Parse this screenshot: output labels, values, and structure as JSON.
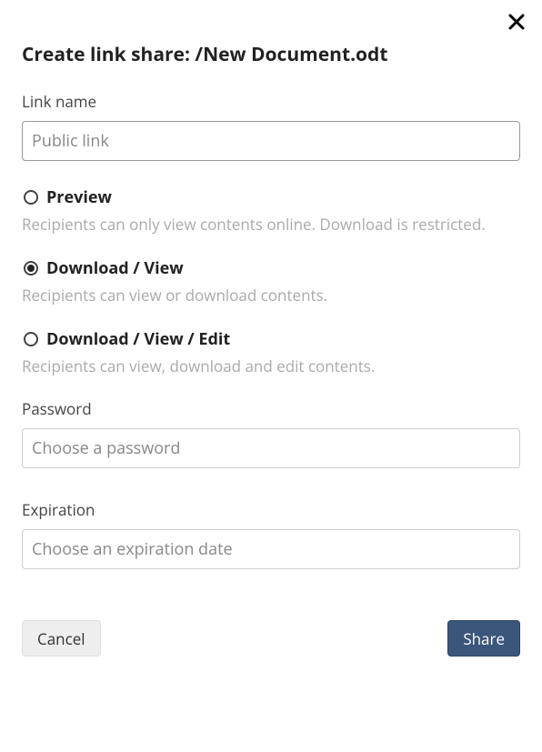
{
  "title": "Create link share: /New Document.odt",
  "linkName": {
    "label": "Link name",
    "placeholder": "Public link",
    "value": ""
  },
  "options": [
    {
      "id": "preview",
      "label": "Preview",
      "description": "Recipients can only view contents online. Download is restricted.",
      "selected": false
    },
    {
      "id": "download-view",
      "label": "Download / View",
      "description": "Recipients can view or download contents.",
      "selected": true
    },
    {
      "id": "download-view-edit",
      "label": "Download / View / Edit",
      "description": "Recipients can view, download and edit contents.",
      "selected": false
    }
  ],
  "password": {
    "label": "Password",
    "placeholder": "Choose a password",
    "value": ""
  },
  "expiration": {
    "label": "Expiration",
    "placeholder": "Choose an expiration date",
    "value": ""
  },
  "buttons": {
    "cancel": "Cancel",
    "share": "Share"
  }
}
